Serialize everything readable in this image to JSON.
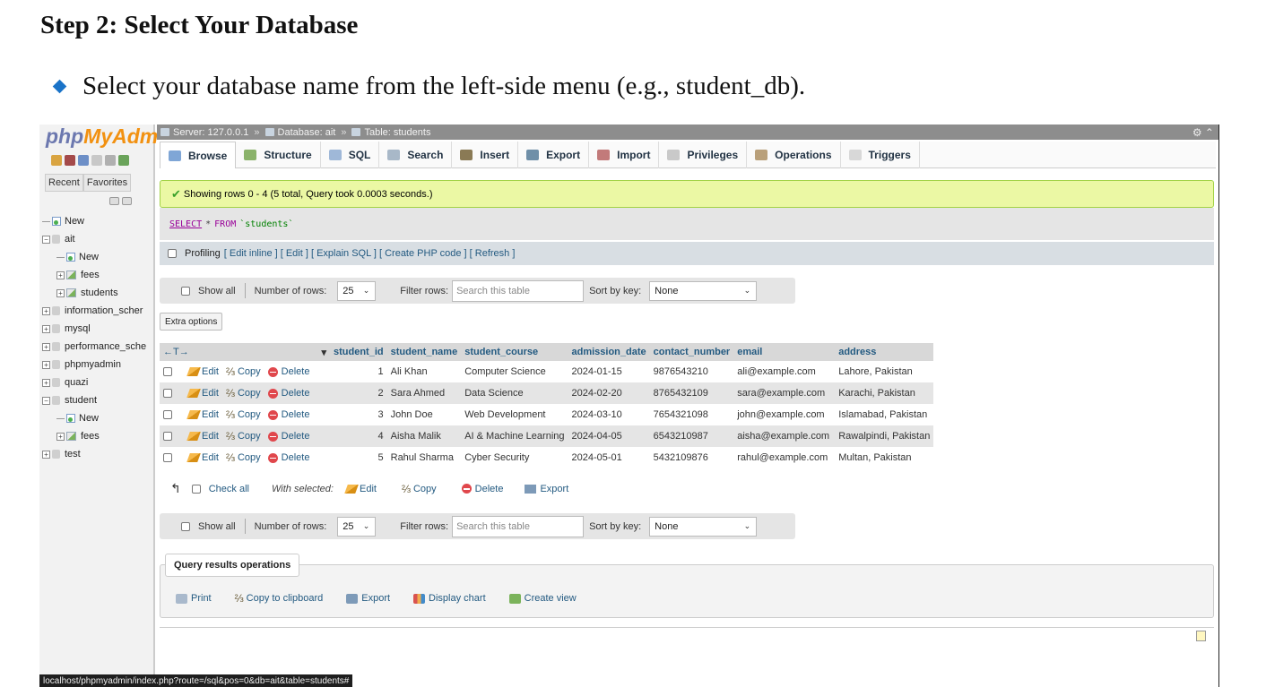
{
  "doc": {
    "heading": "Step 2: Select Your Database",
    "bullet": "Select your database name from the left-side menu (e.g., student_db)."
  },
  "sidebar": {
    "logo_php": "php",
    "logo_myadmin": "MyAdm",
    "tabs": [
      "Recent",
      "Favorites"
    ],
    "tree": [
      {
        "label": "New",
        "level": 0,
        "icon": "new-icon",
        "toggle": "line"
      },
      {
        "label": "ait",
        "level": 0,
        "icon": "database-icon",
        "toggle": "minus"
      },
      {
        "label": "New",
        "level": 1,
        "icon": "new-icon",
        "toggle": "line"
      },
      {
        "label": "fees",
        "level": 1,
        "icon": "table-icon",
        "toggle": "plus"
      },
      {
        "label": "students",
        "level": 1,
        "icon": "table-icon",
        "toggle": "plus"
      },
      {
        "label": "information_scher",
        "level": 0,
        "icon": "database-icon",
        "toggle": "plus"
      },
      {
        "label": "mysql",
        "level": 0,
        "icon": "database-icon",
        "toggle": "plus"
      },
      {
        "label": "performance_sche",
        "level": 0,
        "icon": "database-icon",
        "toggle": "plus"
      },
      {
        "label": "phpmyadmin",
        "level": 0,
        "icon": "database-icon",
        "toggle": "plus"
      },
      {
        "label": "quazi",
        "level": 0,
        "icon": "database-icon",
        "toggle": "plus"
      },
      {
        "label": "student",
        "level": 0,
        "icon": "database-icon",
        "toggle": "minus"
      },
      {
        "label": "New",
        "level": 1,
        "icon": "new-icon",
        "toggle": "line"
      },
      {
        "label": "fees",
        "level": 1,
        "icon": "table-icon",
        "toggle": "plus"
      },
      {
        "label": "test",
        "level": 0,
        "icon": "database-icon",
        "toggle": "plus"
      }
    ]
  },
  "breadcrumb": {
    "server": "Server: 127.0.0.1",
    "database": "Database: ait",
    "table": "Table: students"
  },
  "tabs": [
    {
      "label": "Browse",
      "icon": "browse-icon",
      "color": "#7fa6d6"
    },
    {
      "label": "Structure",
      "icon": "structure-icon",
      "color": "#8bb36b"
    },
    {
      "label": "SQL",
      "icon": "sql-icon",
      "color": "#9fb8d8"
    },
    {
      "label": "Search",
      "icon": "search-icon",
      "color": "#a8b8c8"
    },
    {
      "label": "Insert",
      "icon": "insert-icon",
      "color": "#8a7a55"
    },
    {
      "label": "Export",
      "icon": "export-icon",
      "color": "#6f8fa8"
    },
    {
      "label": "Import",
      "icon": "import-icon",
      "color": "#c27a7a"
    },
    {
      "label": "Privileges",
      "icon": "privileges-icon",
      "color": "#c9c9c9"
    },
    {
      "label": "Operations",
      "icon": "operations-icon",
      "color": "#b9a07a"
    },
    {
      "label": "Triggers",
      "icon": "triggers-icon",
      "color": "#d8d8d8"
    }
  ],
  "message": "Showing rows 0 - 4 (5 total, Query took 0.0003 seconds.)",
  "sql": {
    "select": "SELECT",
    "star": "*",
    "from": "FROM",
    "table": "`students`"
  },
  "profiling": {
    "label": "Profiling",
    "links": "[ Edit inline ] [ Edit ] [ Explain SQL ] [ Create PHP code ] [ Refresh ]"
  },
  "nav": {
    "show_all": "Show all",
    "num_rows_label": "Number of rows:",
    "num_rows_value": "25",
    "filter_label": "Filter rows:",
    "filter_placeholder": "Search this table",
    "sort_label": "Sort by key:",
    "sort_value": "None"
  },
  "extra_options": "Extra options",
  "table": {
    "columns": [
      "student_id",
      "student_name",
      "student_course",
      "admission_date",
      "contact_number",
      "email",
      "address"
    ],
    "actions": [
      "Edit",
      "Copy",
      "Delete"
    ],
    "rows": [
      [
        "1",
        "Ali Khan",
        "Computer Science",
        "2024-01-15",
        "9876543210",
        "ali@example.com",
        "Lahore, Pakistan"
      ],
      [
        "2",
        "Sara Ahmed",
        "Data Science",
        "2024-02-20",
        "8765432109",
        "sara@example.com",
        "Karachi, Pakistan"
      ],
      [
        "3",
        "John Doe",
        "Web Development",
        "2024-03-10",
        "7654321098",
        "john@example.com",
        "Islamabad, Pakistan"
      ],
      [
        "4",
        "Aisha Malik",
        "AI & Machine Learning",
        "2024-04-05",
        "6543210987",
        "aisha@example.com",
        "Rawalpindi, Pakistan"
      ],
      [
        "5",
        "Rahul Sharma",
        "Cyber Security",
        "2024-05-01",
        "5432109876",
        "rahul@example.com",
        "Multan, Pakistan"
      ]
    ]
  },
  "with_selected": {
    "check_all": "Check all",
    "label": "With selected:",
    "edit": "Edit",
    "copy": "Copy",
    "delete": "Delete",
    "export": "Export"
  },
  "query_ops": {
    "title": "Query results operations",
    "print": "Print",
    "copy": "Copy to clipboard",
    "export": "Export",
    "chart": "Display chart",
    "view": "Create view"
  },
  "status_url": "localhost/phpmyadmin/index.php?route=/sql&pos=0&db=ait&table=students#"
}
